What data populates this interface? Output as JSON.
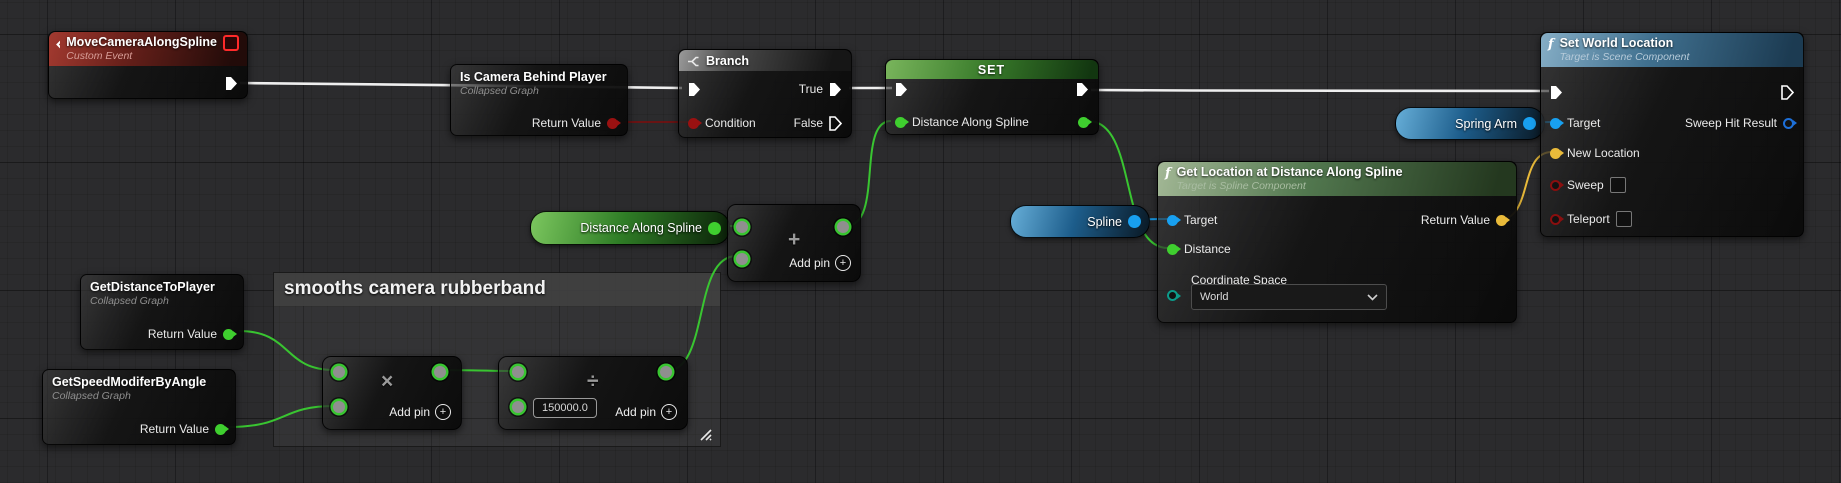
{
  "colors": {
    "exec_wire": "#efefef",
    "float_pin": "#3fcf2f",
    "object_pin": "#18a0f0",
    "vector_pin": "#e9ba3a",
    "boolean_pin": "#991111",
    "enum_pin": "#0d9b8a",
    "struct_pin": "#1d6fd8",
    "event_header": "#a33a30",
    "set_header": "#4e8f3a",
    "function_blue_header": "#40708f",
    "function_green_header": "#52784f",
    "comment_header": "#404040"
  },
  "icons": {
    "plus": "+",
    "multiply": "×",
    "divide": "÷",
    "function": "f",
    "chevron": "⌄"
  },
  "nodes": {
    "custom_event": {
      "title": "MoveCameraAlongSpline",
      "subtitle": "Custom Event"
    },
    "is_camera_behind_player": {
      "title": "Is Camera Behind Player",
      "subtitle": "Collapsed Graph",
      "output": "Return Value"
    },
    "branch": {
      "title": "Branch",
      "condition": "Condition",
      "true_pin": "True",
      "false_pin": "False"
    },
    "set_distance": {
      "title": "SET",
      "pin": "Distance Along Spline"
    },
    "spring_arm": {
      "label": "Spring Arm"
    },
    "spline": {
      "label": "Spline"
    },
    "distance_along_spline_get": {
      "label": "Distance Along Spline"
    },
    "set_world_location": {
      "title": "Set World Location",
      "subtitle": "Target is Scene Component",
      "target": "Target",
      "new_location": "New Location",
      "sweep": "Sweep",
      "teleport": "Teleport",
      "sweep_hit_result": "Sweep Hit Result"
    },
    "get_location_at_distance": {
      "title": "Get Location at Distance Along Spline",
      "subtitle": "Target is Spline Component",
      "target": "Target",
      "distance": "Distance",
      "coordinate_space": "Coordinate Space",
      "coordinate_space_value": "World",
      "return_value": "Return Value"
    },
    "add_node": {
      "add_pin": "Add pin"
    },
    "multiply_node": {
      "add_pin": "Add pin"
    },
    "divide_node": {
      "add_pin": "Add pin",
      "value": "150000.0"
    },
    "get_distance_to_player": {
      "title": "GetDistanceToPlayer",
      "subtitle": "Collapsed Graph",
      "output": "Return Value"
    },
    "get_speed_modifer_by_angle": {
      "title": "GetSpeedModiferByAngle",
      "subtitle": "Collapsed Graph",
      "output": "Return Value"
    },
    "comment": {
      "title": "smooths camera rubberband"
    }
  }
}
